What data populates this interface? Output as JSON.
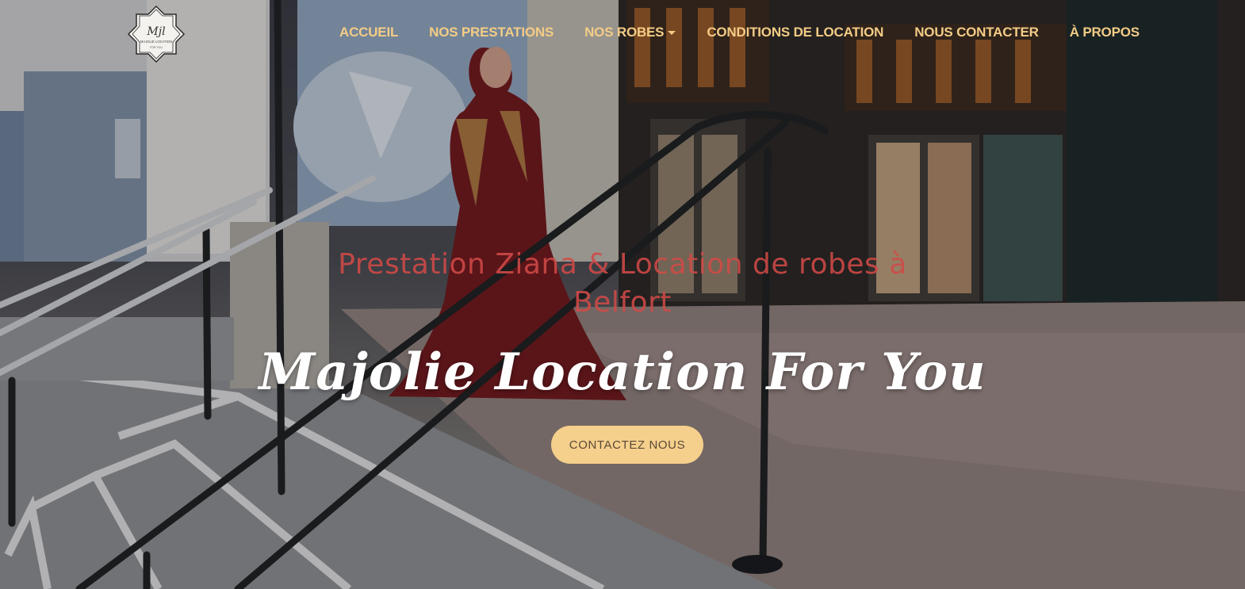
{
  "brand": {
    "logo_monogram": "Mjl",
    "logo_text": "MAJOLIE LOCATION",
    "logo_subtext": "FOR YOU"
  },
  "nav": {
    "items": [
      {
        "label": "ACCUEIL"
      },
      {
        "label": "NOS PRESTATIONS"
      },
      {
        "label": "NOS ROBES",
        "has_dropdown": true
      },
      {
        "label": "CONDITIONS DE LOCATION"
      },
      {
        "label": "NOUS CONTACTER"
      },
      {
        "label": "À PROPOS"
      }
    ]
  },
  "hero": {
    "subtitle": "Prestation Ziana & Location de robes à Belfort",
    "title": "Majolie Location For You",
    "cta_label": "CONTACTEZ NOUS"
  },
  "colors": {
    "nav_text": "#f3cc86",
    "subtitle": "#d14a47",
    "title": "#ffffff",
    "cta_background": "#f5cf8c",
    "cta_text": "#5b4a37"
  },
  "icons": {
    "dropdown": "caret-down-icon"
  }
}
